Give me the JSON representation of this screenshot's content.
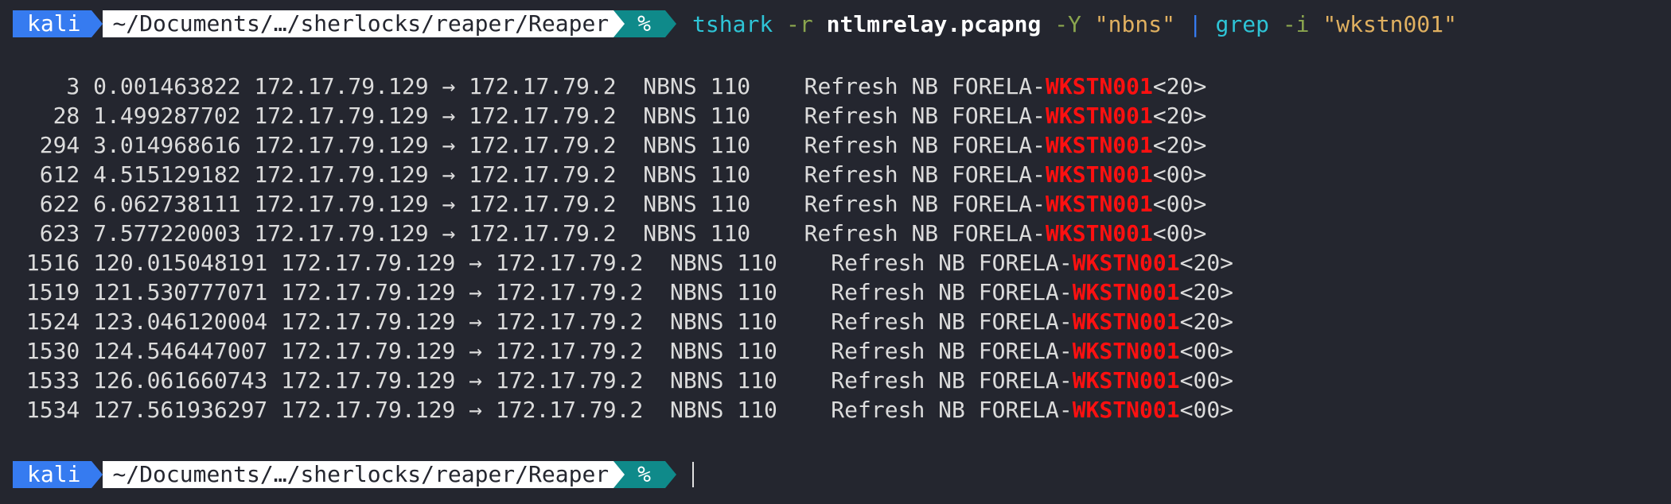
{
  "prompt": {
    "user": "kali",
    "path": "~/Documents/…/sherlocks/reaper/Reaper",
    "symbol": "%"
  },
  "command": {
    "program": "tshark",
    "flag_r": "-r",
    "file": "ntlmrelay.pcapng",
    "flag_Y": "-Y",
    "filter": "\"nbns\"",
    "pipe": "|",
    "grep": "grep",
    "flag_i": "-i",
    "pattern": "\"wkstn001\""
  },
  "output": [
    {
      "text": "    3 0.001463822 172.17.79.129 → 172.17.79.2  NBNS 110    Refresh NB FORELA-",
      "match": "WKSTN001",
      "suffix": "<20>"
    },
    {
      "text": "   28 1.499287702 172.17.79.129 → 172.17.79.2  NBNS 110    Refresh NB FORELA-",
      "match": "WKSTN001",
      "suffix": "<20>"
    },
    {
      "text": "  294 3.014968616 172.17.79.129 → 172.17.79.2  NBNS 110    Refresh NB FORELA-",
      "match": "WKSTN001",
      "suffix": "<20>"
    },
    {
      "text": "  612 4.515129182 172.17.79.129 → 172.17.79.2  NBNS 110    Refresh NB FORELA-",
      "match": "WKSTN001",
      "suffix": "<00>"
    },
    {
      "text": "  622 6.062738111 172.17.79.129 → 172.17.79.2  NBNS 110    Refresh NB FORELA-",
      "match": "WKSTN001",
      "suffix": "<00>"
    },
    {
      "text": "  623 7.577220003 172.17.79.129 → 172.17.79.2  NBNS 110    Refresh NB FORELA-",
      "match": "WKSTN001",
      "suffix": "<00>"
    },
    {
      "text": " 1516 120.015048191 172.17.79.129 → 172.17.79.2  NBNS 110    Refresh NB FORELA-",
      "match": "WKSTN001",
      "suffix": "<20>"
    },
    {
      "text": " 1519 121.530777071 172.17.79.129 → 172.17.79.2  NBNS 110    Refresh NB FORELA-",
      "match": "WKSTN001",
      "suffix": "<20>"
    },
    {
      "text": " 1524 123.046120004 172.17.79.129 → 172.17.79.2  NBNS 110    Refresh NB FORELA-",
      "match": "WKSTN001",
      "suffix": "<20>"
    },
    {
      "text": " 1530 124.546447007 172.17.79.129 → 172.17.79.2  NBNS 110    Refresh NB FORELA-",
      "match": "WKSTN001",
      "suffix": "<00>"
    },
    {
      "text": " 1533 126.061660743 172.17.79.129 → 172.17.79.2  NBNS 110    Refresh NB FORELA-",
      "match": "WKSTN001",
      "suffix": "<00>"
    },
    {
      "text": " 1534 127.561936297 172.17.79.129 → 172.17.79.2  NBNS 110    Refresh NB FORELA-",
      "match": "WKSTN001",
      "suffix": "<00>"
    }
  ],
  "colors": {
    "background": "#24262f",
    "prompt_user_bg": "#367bf0",
    "prompt_symbol_bg": "#0f8a8a",
    "highlight": "#ff1010"
  }
}
